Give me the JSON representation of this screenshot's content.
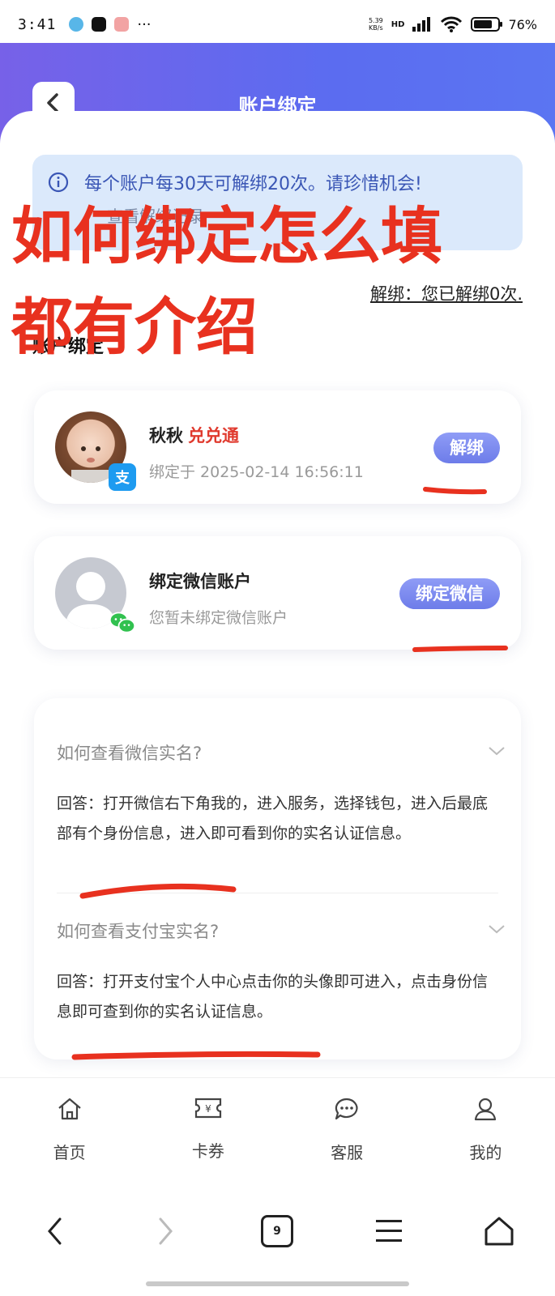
{
  "status_bar": {
    "time": "3:41",
    "more": "···",
    "net_speed_top": "5.39",
    "net_speed_bottom": "KB/s",
    "network": "HD",
    "battery": "76%"
  },
  "header": {
    "title": "账户绑定"
  },
  "notice": {
    "text": "每个账户每30天可解绑20次。请珍惜机会!",
    "link": "查看解绑记录"
  },
  "unbind_count": "解绑：您已解绑0次.",
  "section_label": "账户绑定",
  "alipay_card": {
    "name": "秋秋",
    "tag": "兑兑通",
    "bound_time": "绑定于 2025-02-14 16:56:11",
    "badge": "支",
    "action": "解绑",
    "badge_color": "#1e9bf0"
  },
  "wechat_card": {
    "name": "绑定微信账户",
    "sub": "您暂未绑定微信账户",
    "action": "绑定微信",
    "badge_color": "#31c14f"
  },
  "faq": [
    {
      "q": "如何查看微信实名?",
      "a": "回答：打开微信右下角我的，进入服务，选择钱包，进入后最底部有个身份信息，进入即可看到你的实名认证信息。"
    },
    {
      "q": "如何查看支付宝实名?",
      "a": "回答：打开支付宝个人中心点击你的头像即可进入，点击身份信息即可查到你的实名认证信息。"
    }
  ],
  "tabs": [
    {
      "label": "首页",
      "icon": "home-icon"
    },
    {
      "label": "卡券",
      "icon": "coupon-icon"
    },
    {
      "label": "客服",
      "icon": "chat-icon"
    },
    {
      "label": "我的",
      "icon": "user-icon"
    }
  ],
  "browser_nav": {
    "tab_count": "9"
  },
  "overlay": {
    "line1": "如何绑定怎么填",
    "line2": "都有介绍",
    "color": "#e8311f"
  }
}
